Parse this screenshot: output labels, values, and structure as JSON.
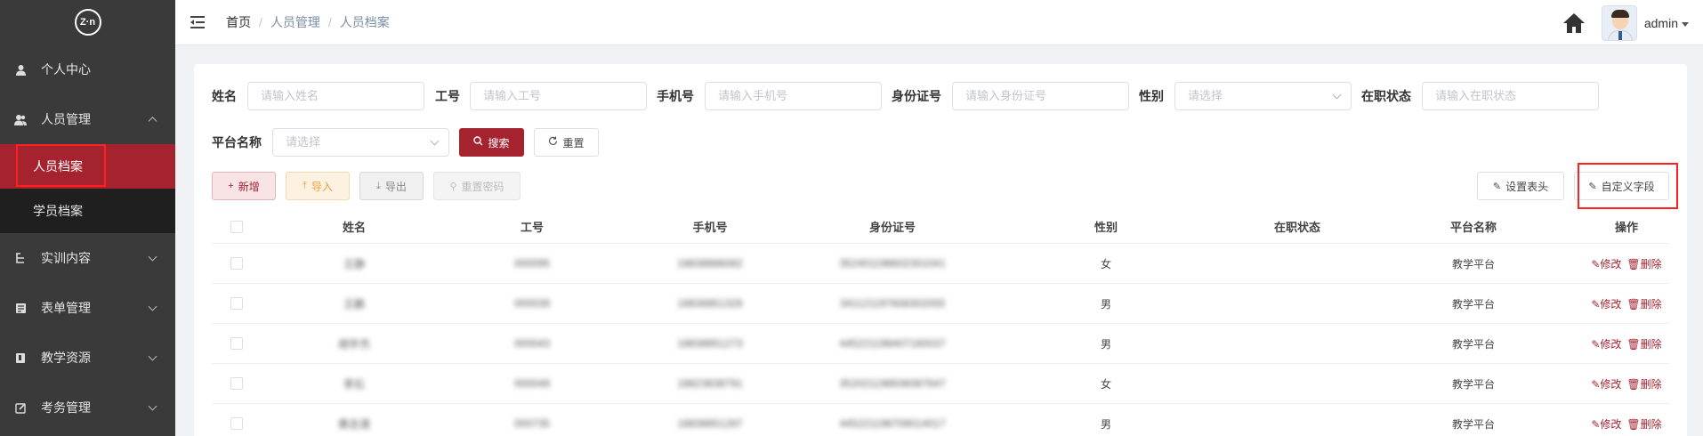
{
  "sidebar": {
    "logo": "Z·n",
    "items": [
      {
        "label": "个人中心",
        "icon": "user-icon"
      },
      {
        "label": "人员管理",
        "icon": "users-icon",
        "expanded": true,
        "children": [
          {
            "label": "人员档案",
            "active": true
          },
          {
            "label": "学员档案"
          }
        ]
      },
      {
        "label": "实训内容",
        "icon": "tree-icon"
      },
      {
        "label": "表单管理",
        "icon": "form-icon"
      },
      {
        "label": "教学资源",
        "icon": "book-icon"
      },
      {
        "label": "考务管理",
        "icon": "edit-icon"
      }
    ]
  },
  "header": {
    "breadcrumb": [
      "首页",
      "人员管理",
      "人员档案"
    ],
    "username": "admin"
  },
  "search": {
    "name_label": "姓名",
    "name_placeholder": "请输入姓名",
    "empno_label": "工号",
    "empno_placeholder": "请输入工号",
    "phone_label": "手机号",
    "phone_placeholder": "请输入手机号",
    "idcard_label": "身份证号",
    "idcard_placeholder": "请输入身份证号",
    "gender_label": "性别",
    "gender_placeholder": "请选择",
    "status_label": "在职状态",
    "status_placeholder": "请输入在职状态",
    "platform_label": "平台名称",
    "platform_placeholder": "请选择",
    "search_btn": "搜索",
    "reset_btn": "重置"
  },
  "toolbar": {
    "add": "新增",
    "import": "导入",
    "export": "导出",
    "reset_pwd": "重置密码",
    "set_header": "设置表头",
    "custom_field": "自定义字段"
  },
  "table": {
    "headers": [
      "姓名",
      "工号",
      "手机号",
      "身份证号",
      "性别",
      "在职状态",
      "平台名称",
      "操作"
    ],
    "edit_label": "修改",
    "delete_label": "删除",
    "rows": [
      {
        "name": "王静",
        "empno": "000095",
        "phone": "18838886082",
        "idcard": "352401198602301041",
        "gender": "女",
        "status": "",
        "platform": "教学平台"
      },
      {
        "name": "王鹏",
        "empno": "000039",
        "phone": "18836851326",
        "idcard": "341121197608302055",
        "gender": "男",
        "status": "",
        "platform": "教学平台"
      },
      {
        "name": "胡宇杰",
        "empno": "000043",
        "phone": "18838851273",
        "idcard": "445221198407160037",
        "gender": "男",
        "status": "",
        "platform": "教学平台"
      },
      {
        "name": "李石",
        "empno": "000049",
        "phone": "18823838791",
        "idcard": "352021198506087647",
        "gender": "女",
        "status": "",
        "platform": "教学平台"
      },
      {
        "name": "黄志清",
        "empno": "000735",
        "phone": "18838851287",
        "idcard": "445221198709014017",
        "gender": "男",
        "status": "",
        "platform": "教学平台"
      }
    ]
  }
}
